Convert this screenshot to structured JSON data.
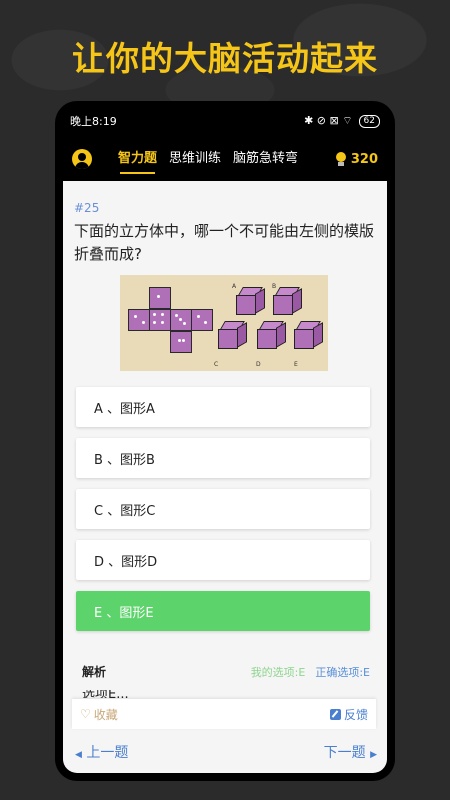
{
  "headline": "让你的大脑活动起来",
  "status": {
    "time": "晚上8:19",
    "icons": "✱ ⊘ ⊠ ⌔",
    "battery": "62"
  },
  "nav": {
    "tabs": [
      {
        "label": "智力题",
        "active": true
      },
      {
        "label": "思维训练",
        "active": false
      },
      {
        "label": "脑筋急转弯",
        "active": false
      }
    ],
    "coins": "320"
  },
  "question": {
    "number": "#25",
    "text": "下面的立方体中，哪一个不可能由左侧的模版折叠而成?",
    "figure_labels": [
      "A",
      "B",
      "C",
      "D",
      "E"
    ]
  },
  "options": [
    {
      "label": "A 、图形A",
      "correct": false
    },
    {
      "label": "B 、图形B",
      "correct": false
    },
    {
      "label": "C 、图形C",
      "correct": false
    },
    {
      "label": "D 、图形D",
      "correct": false
    },
    {
      "label": "E 、图形E",
      "correct": true
    }
  ],
  "analysis": {
    "label": "解析",
    "my_choice": "我的选项:E",
    "correct_choice": "正确选项:E",
    "partial_text": "选项E..."
  },
  "actions": {
    "favorite": "收藏",
    "feedback": "反馈"
  },
  "pager": {
    "prev": "上一题",
    "next": "下一题"
  },
  "colors": {
    "accent": "#f5c518",
    "correct": "#5dd36b",
    "link": "#4a7fd0"
  }
}
